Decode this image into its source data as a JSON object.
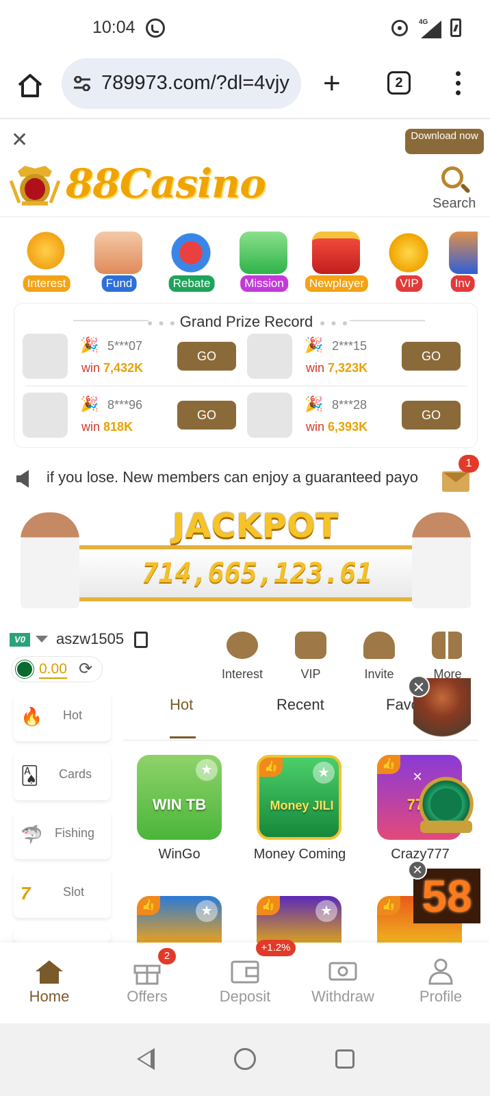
{
  "status_bar": {
    "time": "10:04",
    "network": "4G"
  },
  "browser": {
    "url": "789973.com/?dl=4vjy",
    "tab_count": "2"
  },
  "download_banner": {
    "button": "Download now"
  },
  "header": {
    "logo": "88Casino",
    "search_label": "Search"
  },
  "categories": [
    {
      "label": "Interest",
      "color": "#f3a316"
    },
    {
      "label": "Fund",
      "color": "#2f6fd8"
    },
    {
      "label": "Rebate",
      "color": "#1fa35a"
    },
    {
      "label": "Mission",
      "color": "#c23ad8"
    },
    {
      "label": "Newplayer",
      "color": "#f3a316"
    },
    {
      "label": "VIP",
      "color": "#e23a3a"
    },
    {
      "label": "Inv",
      "color": "#e23a3a"
    }
  ],
  "grand_prize": {
    "title": "Grand Prize Record",
    "entries": [
      {
        "user": "5***07",
        "win_prefix": "win",
        "amount": "7,432K",
        "button": "GO"
      },
      {
        "user": "2***15",
        "win_prefix": "win",
        "amount": "7,323K",
        "button": "GO"
      },
      {
        "user": "8***96",
        "win_prefix": "win",
        "amount": "818K",
        "button": "GO"
      },
      {
        "user": "8***28",
        "win_prefix": "win",
        "amount": "6,393K",
        "button": "GO"
      }
    ]
  },
  "marquee": {
    "text": "if you lose.   New members can enjoy a guaranteed payo",
    "mail_badge": "1"
  },
  "jackpot": {
    "title": "JACKPOT",
    "amount": "714,665,123.61"
  },
  "account": {
    "vip_level": "V0",
    "username": "aszw1505",
    "balance": "0.00"
  },
  "quick_actions": [
    {
      "label": "Interest"
    },
    {
      "label": "VIP"
    },
    {
      "label": "Invite"
    },
    {
      "label": "More"
    }
  ],
  "side_menu": [
    {
      "label": "Hot",
      "icon": "🔥"
    },
    {
      "label": "Cards",
      "icon": "🂡"
    },
    {
      "label": "Fishing",
      "icon": "🦈"
    },
    {
      "label": "Slot",
      "icon": "7"
    }
  ],
  "game_tabs": [
    {
      "label": "Hot"
    },
    {
      "label": "Recent"
    },
    {
      "label": "Favo"
    }
  ],
  "games": [
    {
      "name": "WinGo",
      "art": "WIN TB"
    },
    {
      "name": "Money Coming",
      "art": "Money JILI"
    },
    {
      "name": "Crazy777",
      "art": "777"
    }
  ],
  "floating": {
    "number_widget": "58"
  },
  "bottom_nav": [
    {
      "label": "Home"
    },
    {
      "label": "Offers",
      "badge": "2"
    },
    {
      "label": "Deposit",
      "badge": "+1.2%"
    },
    {
      "label": "Withdraw"
    },
    {
      "label": "Profile"
    }
  ]
}
